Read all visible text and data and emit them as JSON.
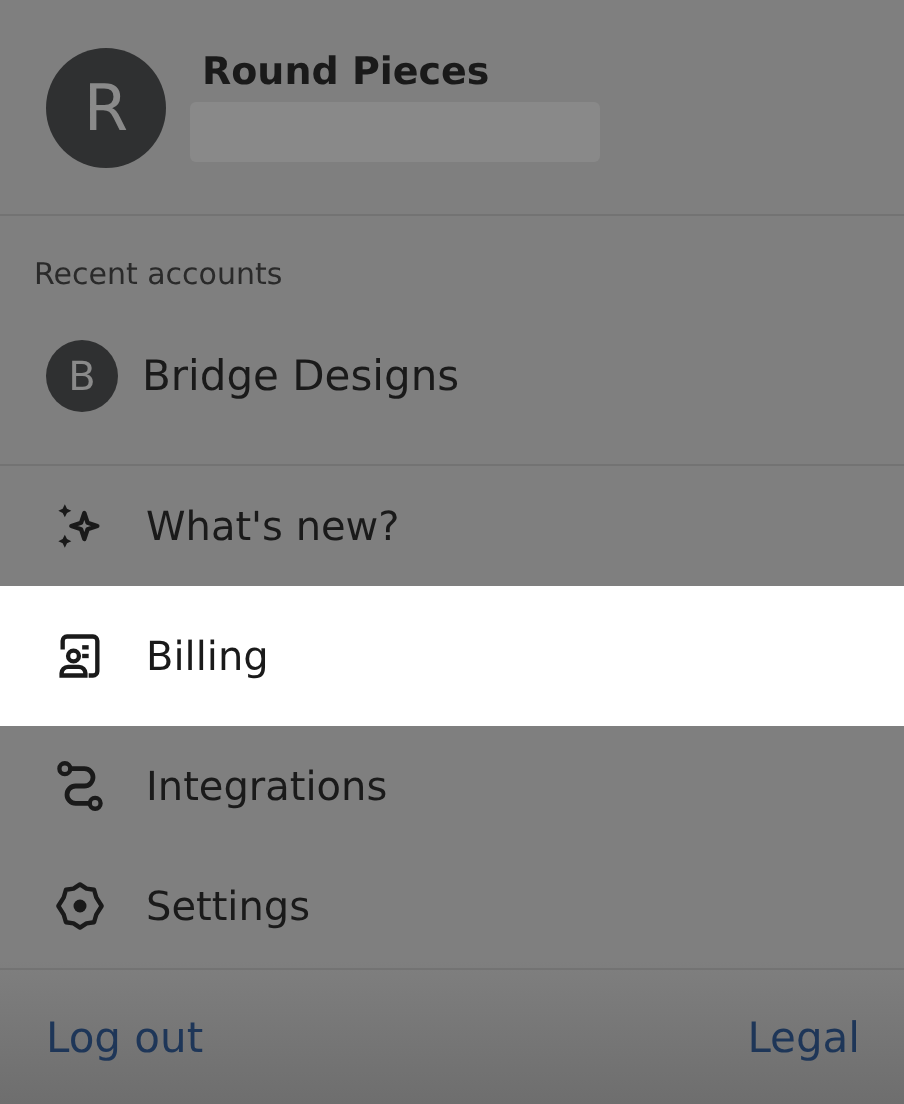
{
  "account": {
    "initial": "R",
    "name": "Round Pieces"
  },
  "recent": {
    "heading": "Recent accounts",
    "accounts": [
      {
        "initial": "B",
        "name": "Bridge Designs"
      }
    ]
  },
  "menu": [
    {
      "kind": "sparkle",
      "label": "What's new?",
      "selected": false
    },
    {
      "kind": "billing",
      "label": "Billing",
      "selected": true
    },
    {
      "kind": "integrations",
      "label": "Integrations",
      "selected": false
    },
    {
      "kind": "settings",
      "label": "Settings",
      "selected": false
    }
  ],
  "footer": {
    "left": "Log out",
    "right": "Legal"
  }
}
